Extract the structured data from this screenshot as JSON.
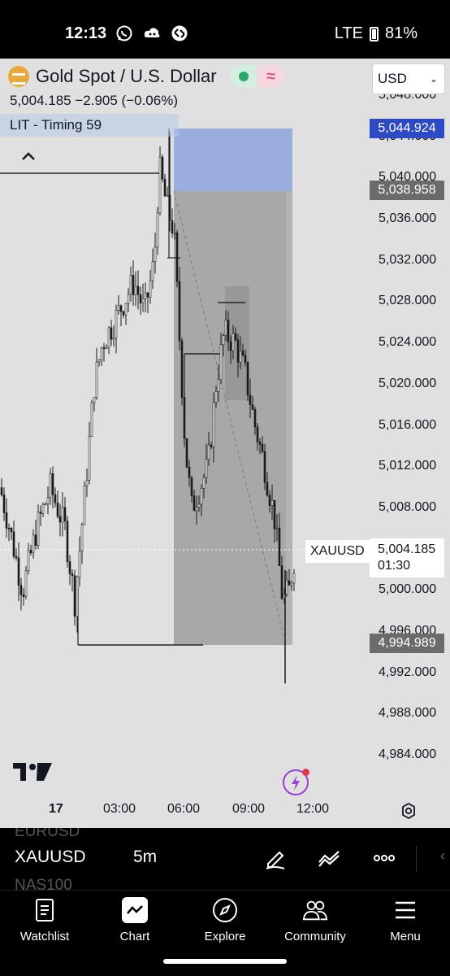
{
  "status": {
    "time": "12:13",
    "network": "LTE",
    "battery": "81%"
  },
  "chart_header": {
    "symbol_title": "Gold Spot / U.S. Dollar",
    "price_summary": "5,004.185  −2.905 (−0.06%)",
    "indicator": "LIT - Timing 59",
    "currency": "USD"
  },
  "chart_data": {
    "type": "candlestick",
    "symbol": "XAUUSD",
    "interval": "5m",
    "x_ticks": [
      "17",
      "03:00",
      "06:00",
      "09:00",
      "12:00"
    ],
    "y_ticks": [
      "5,048.000",
      "5,044.000",
      "5,040.000",
      "5,036.000",
      "5,032.000",
      "5,028.000",
      "5,024.000",
      "5,020.000",
      "5,016.000",
      "5,012.000",
      "5,008.000",
      "5,004.000",
      "5,000.000",
      "4,996.000",
      "4,992.000",
      "4,988.000",
      "4,984.000"
    ],
    "ylim": [
      4982,
      5049
    ],
    "last_price": 5004.185,
    "change": -2.905,
    "change_pct": -0.06,
    "short_position": {
      "stop": 5044.924,
      "entry": 5038.958,
      "target": 4994.989
    }
  },
  "price_axis": {
    "stop_label": "5,044.924",
    "entry_label": "5,038.958",
    "target_label": "4,994.989",
    "current_price": "5,004.185",
    "countdown": "01:30",
    "symbol_label": "XAUUSD"
  },
  "toolbar": {
    "symbol": "XAUUSD",
    "interval": "5m",
    "ghost_above": "EURUSD",
    "ghost_below": "NAS100"
  },
  "nav": {
    "watchlist": "Watchlist",
    "chart": "Chart",
    "explore": "Explore",
    "community": "Community",
    "menu": "Menu"
  }
}
